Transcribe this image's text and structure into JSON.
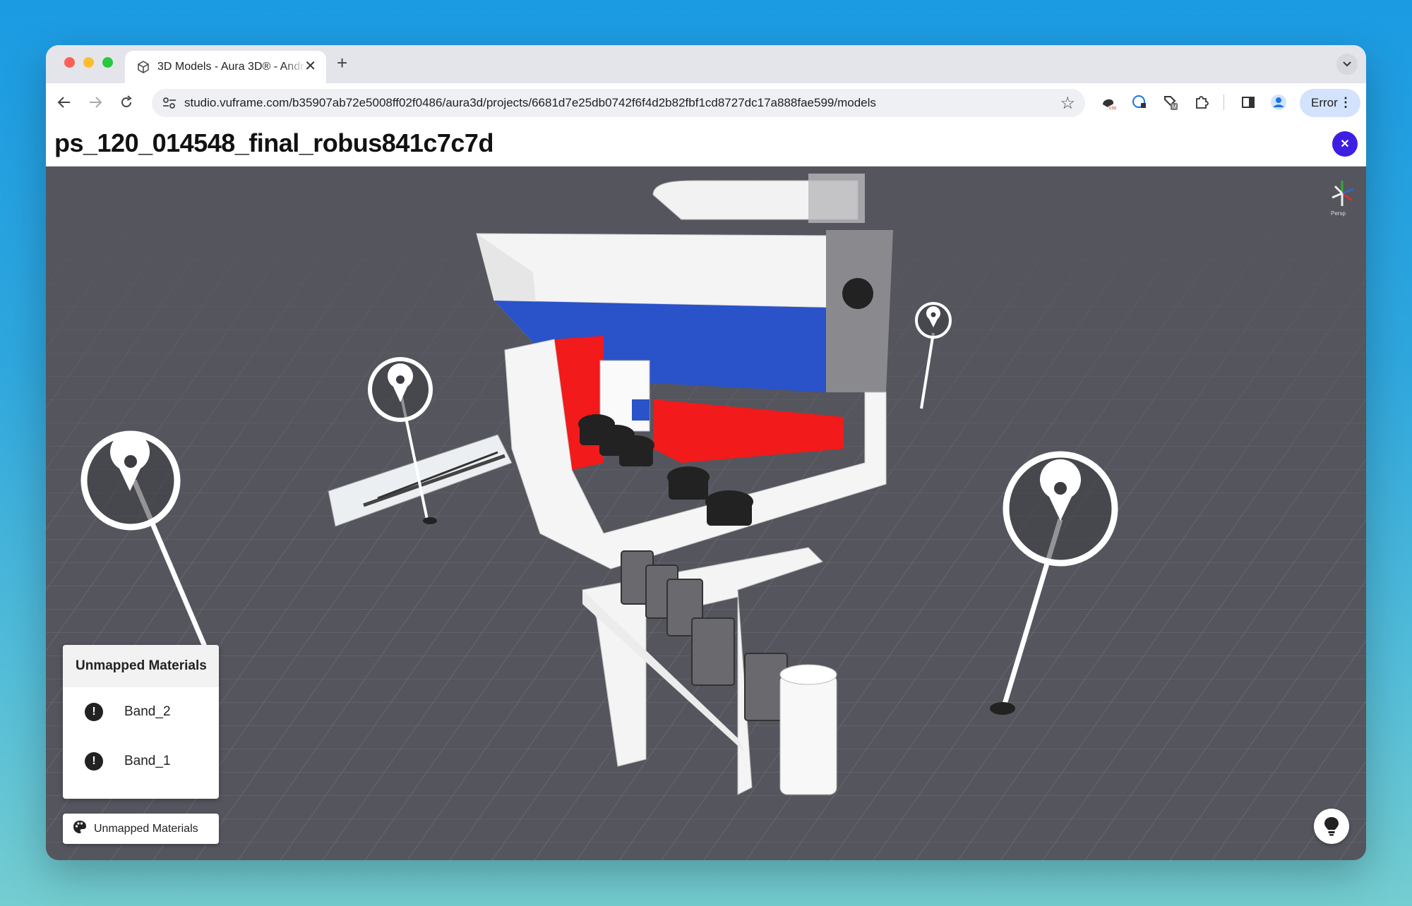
{
  "browser": {
    "tab_title": "3D Models - Aura 3D® - Andr",
    "url": "studio.vuframe.com/b35907ab72e5008ff02f0486/aura3d/projects/6681d7e25db0742f6f4d2b82fbf1cd8727dc17a888fae599/models",
    "error_label": "Error",
    "new_tab_glyph": "+",
    "close_tab_glyph": "✕"
  },
  "page": {
    "title": "ps_120_014548_final_robus841c7c7d",
    "close_glyph": "✕"
  },
  "viewer": {
    "gizmo_label": "Persp",
    "hotspot_count": 4
  },
  "unmapped_panel": {
    "heading": "Unmapped Materials",
    "items": [
      {
        "name": "Band_2",
        "icon": "alert-icon"
      },
      {
        "name": "Band_1",
        "icon": "alert-icon"
      }
    ]
  },
  "bottom_button": {
    "label": "Unmapped Materials",
    "icon": "palette-icon"
  },
  "colors": {
    "accent": "#3d1fe3",
    "viewport_bg": "#55555e",
    "machine_red": "#f21a1a",
    "machine_blue": "#2a52c9"
  }
}
